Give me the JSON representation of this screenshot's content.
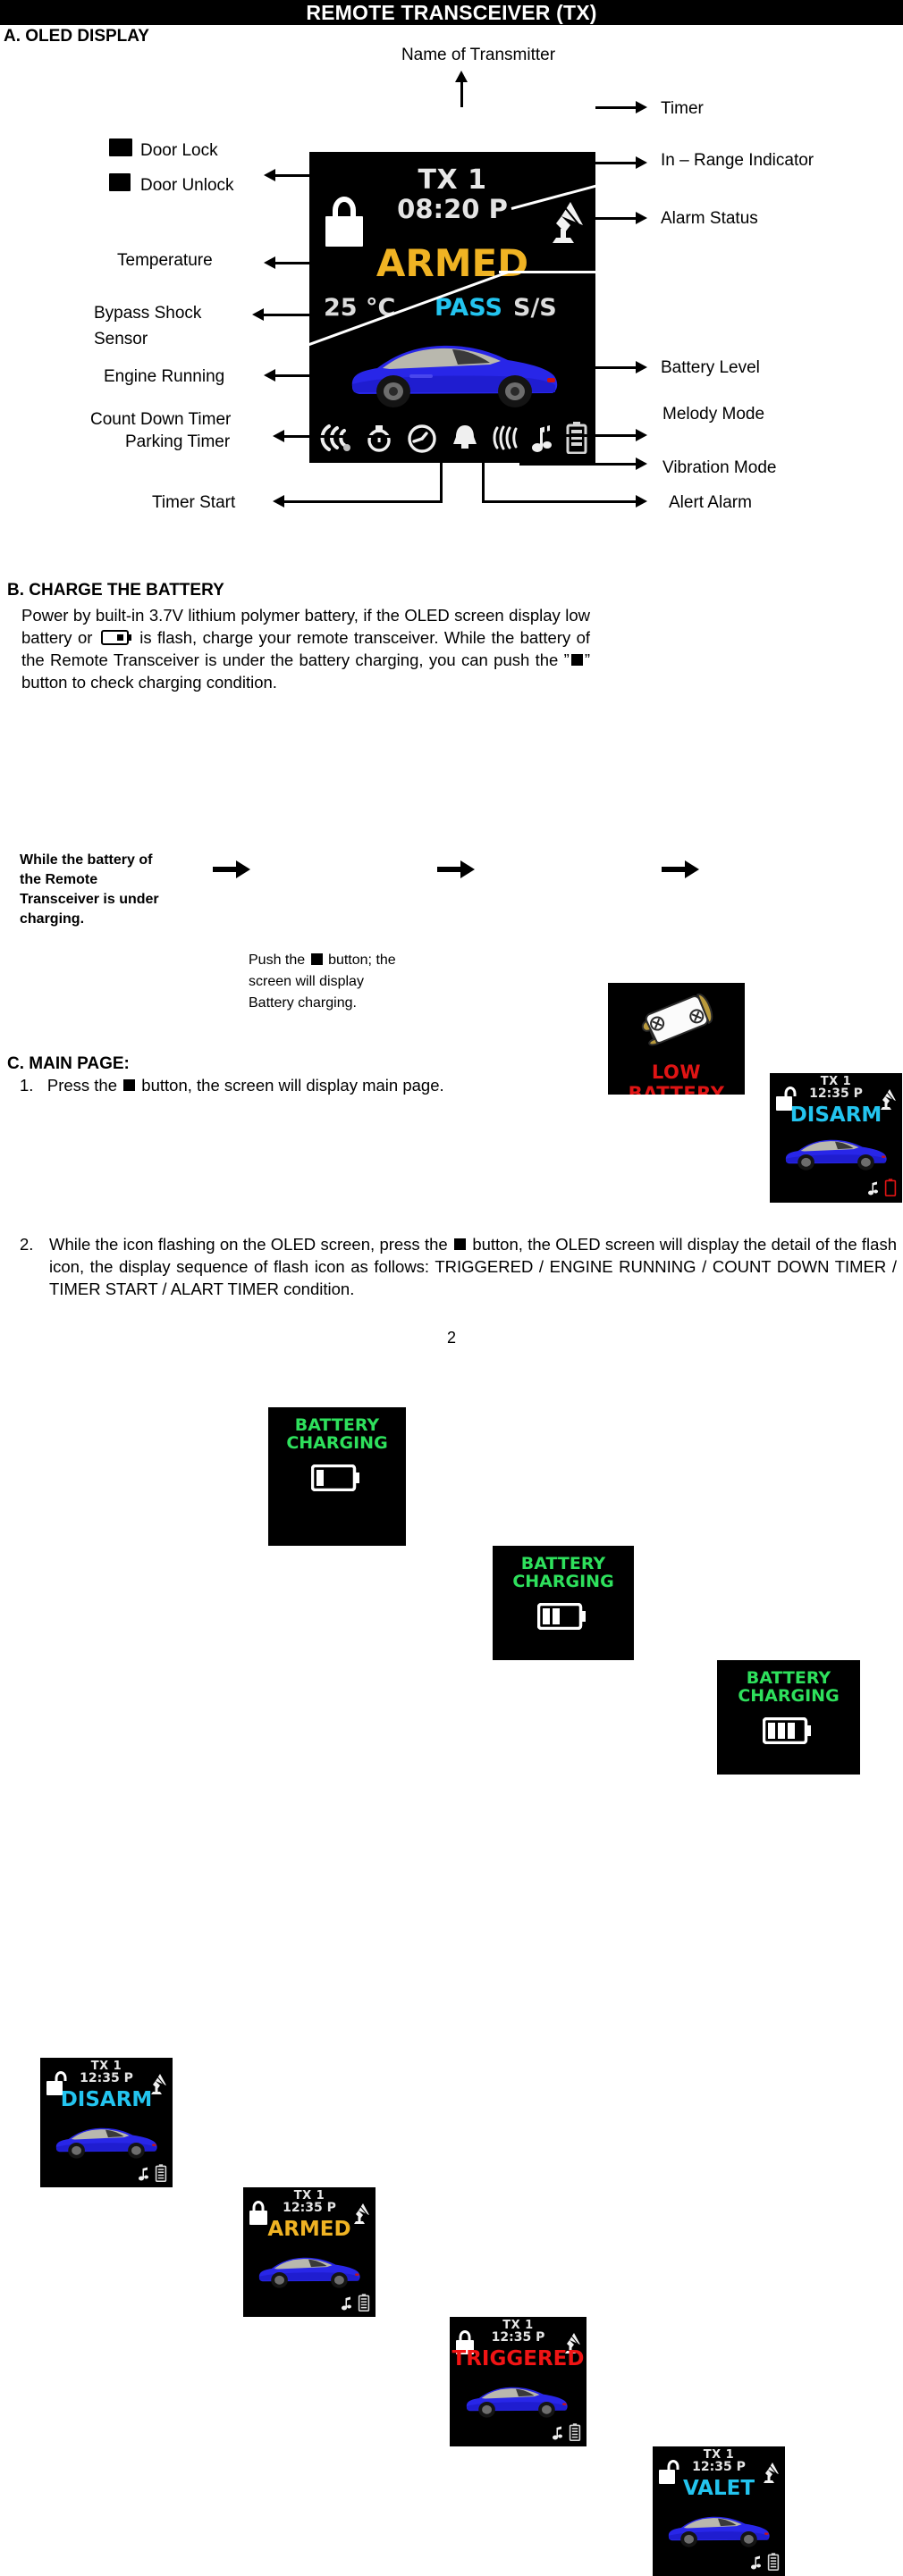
{
  "page": {
    "title": "REMOTE TRANSCEIVER (TX)",
    "number": "2"
  },
  "section_a": {
    "heading": "A. OLED DISPLAY",
    "display": {
      "transmitter_name": "TX 1",
      "time": "08:20 P",
      "alarm_status": "ARMED",
      "temperature": "25 °C",
      "bypass": "PASS",
      "ss": "S/S",
      "lock_state": "locked",
      "icons": [
        "engine-running-icon",
        "countdown-timer-icon",
        "timer-start-icon",
        "alert-alarm-icon",
        "vibration-mode-icon",
        "melody-mode-icon",
        "battery-level-icon"
      ]
    },
    "labels": {
      "name_of_transmitter": "Name of Transmitter",
      "door_lock": "Door Lock",
      "door_unlock": "Door Unlock",
      "temperature": "Temperature",
      "bypass_shock_sensor_1": "Bypass Shock",
      "bypass_shock_sensor_2": "Sensor",
      "engine_running": "Engine Running",
      "count_down_timer": "Count Down Timer",
      "parking_timer": "Parking Timer",
      "timer_start": "Timer Start",
      "timer": "Timer",
      "in_range_indicator": "In – Range Indicator",
      "alarm_status": "Alarm Status",
      "battery_level": "Battery Level",
      "melody_mode": "Melody Mode",
      "vibration_mode": "Vibration Mode",
      "alert_alarm": "Alert Alarm"
    }
  },
  "section_b": {
    "heading": "B. CHARGE THE BATTERY",
    "paragraph_part1": "Power by built-in 3.7V lithium polymer battery, if the OLED screen display low battery or",
    "paragraph_part2": "is flash, charge your remote transceiver. While the battery of the Remote Transceiver is under the battery charging, you can push the ”",
    "paragraph_part3": "” button to check charging condition.",
    "low_battery_screen": {
      "label": "LOW BATTERY",
      "color": "#e01414"
    },
    "disarm_screen": {
      "transmitter_name": "TX 1",
      "time": "12:35 P",
      "status": "DISARM",
      "status_color": "#23c4ef",
      "battery_color": "#e01414"
    },
    "charging_note": {
      "lead_in_1": "While the battery of",
      "lead_in_2": "the Remote",
      "lead_in_3": "Transceiver is under",
      "lead_in_4": "charging.",
      "caption_1": "Push the",
      "caption_2": "button; the",
      "caption_3": "screen will display",
      "caption_4": "Battery charging."
    },
    "charging_screens": [
      {
        "line1": "BATTERY",
        "line2": "CHARGING",
        "bars": 1,
        "color": "#2ee05c"
      },
      {
        "line1": "BATTERY",
        "line2": "CHARGING",
        "bars": 2,
        "color": "#2ee05c"
      },
      {
        "line1": "BATTERY",
        "line2": "CHARGING",
        "bars": 3,
        "color": "#2ee05c"
      }
    ]
  },
  "section_c": {
    "heading": "C. MAIN PAGE:",
    "item1_num": "1.",
    "item1_part1": "Press the",
    "item1_part2": "button, the screen will display main page.",
    "screens": [
      {
        "transmitter_name": "TX 1",
        "time": "12:35 P",
        "status": "DISARM",
        "status_color": "#23c4ef",
        "lock": "unlocked"
      },
      {
        "transmitter_name": "TX 1",
        "time": "12:35 P",
        "status": "ARMED",
        "status_color": "#f0b323",
        "lock": "locked"
      },
      {
        "transmitter_name": "TX 1",
        "time": "12:35 P",
        "status": "TRIGGERED",
        "status_color": "#f01414",
        "lock": "locked"
      },
      {
        "transmitter_name": "TX 1",
        "time": "12:35 P",
        "status": "VALET",
        "status_color": "#23c4ef",
        "lock": "unlocked"
      }
    ],
    "item2_num": "2.",
    "item2_part1": "While the icon flashing on the OLED screen, press the",
    "item2_part2": "button, the OLED screen will display the detail of the flash icon, the display sequence of flash icon as follows: TRIGGERED / ENGINE RUNNING / COUNT DOWN TIMER / TIMER START / ALART TIMER condition."
  }
}
